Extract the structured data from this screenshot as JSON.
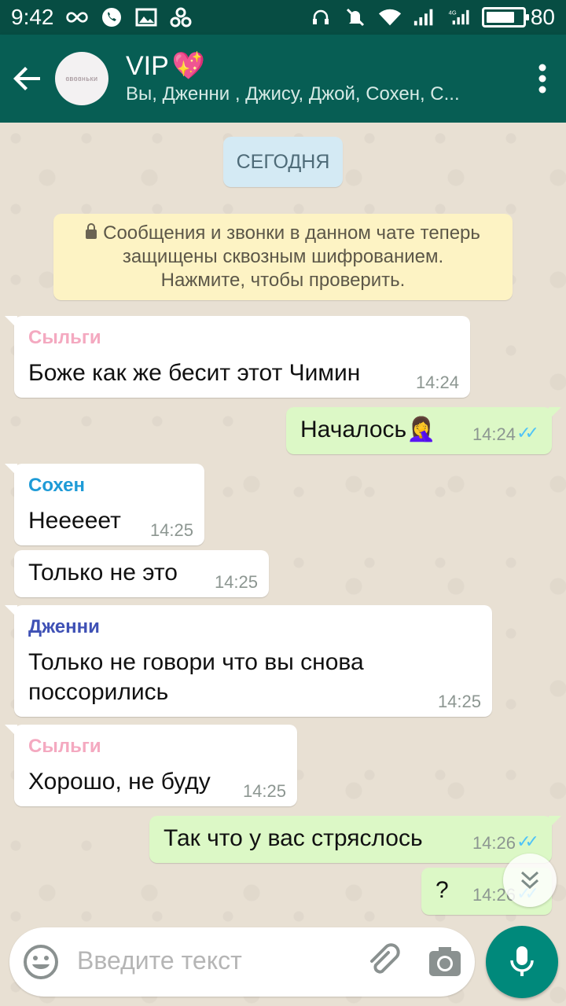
{
  "status_bar": {
    "time": "9:42",
    "battery": "80",
    "battery_level": 0.8
  },
  "header": {
    "title": "VIP",
    "title_emoji": "💖",
    "subtitle": "Вы, Дженни , Джису, Джой, Сохен, С...",
    "avatar_text": "ɞвɞɞньки"
  },
  "chat": {
    "date_chip": "СЕГОДНЯ",
    "system_note": {
      "line1": "Сообщения и звонки в данном чате теперь",
      "line2": "защищены сквозным шифрованием.",
      "line3": "Нажмите, чтобы проверить."
    },
    "messages": [
      {
        "sender": "Сыльги",
        "sender_color": "#f4a9c0",
        "text": "Боже как же бесит этот Чимин",
        "time": "14:24"
      },
      {
        "text": "Началось",
        "emoji": "🤦‍♀️",
        "time": "14:24"
      },
      {
        "sender": "Сохен",
        "sender_color": "#1e9bd7",
        "text": "Неееeет",
        "time": "14:25"
      },
      {
        "text": "Только не это",
        "time": "14:25"
      },
      {
        "sender": "Дженни",
        "sender_color": "#3f51b5",
        "text_line1": "Только не говори что вы снова",
        "text_line2": "поссорились",
        "time": "14:25"
      },
      {
        "sender": "Сыльги",
        "sender_color": "#f4a9c0",
        "text": "Хорошо, не буду",
        "time": "14:25"
      },
      {
        "text": "Так что у вас стряслось",
        "time": "14:26"
      },
      {
        "text": "?",
        "time": "14:26"
      }
    ]
  },
  "input": {
    "placeholder": "Введите текст"
  },
  "colors": {
    "header": "#075e54",
    "status_bar": "#074d43",
    "outgoing_bubble": "#dcf8c6",
    "incoming_bubble": "#ffffff",
    "read_ticks": "#4fc3f7",
    "mic_button": "#00897b"
  },
  "icons": [
    "back-arrow-icon",
    "more-vert-icon",
    "emoji-icon",
    "attach-icon",
    "camera-icon",
    "mic-icon",
    "double-chevron-down-icon",
    "lock-icon",
    "double-check-icon"
  ]
}
